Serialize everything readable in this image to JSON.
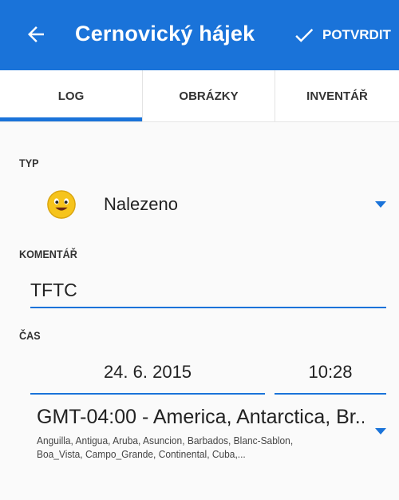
{
  "appbar": {
    "title": "Cernovický hájek",
    "confirm_label": "POTVRDIT",
    "back_icon": "arrow-left-icon",
    "confirm_icon": "check-icon",
    "color": "#1a73d9"
  },
  "tabs": [
    {
      "label": "LOG",
      "selected": true
    },
    {
      "label": "OBRÁZKY",
      "selected": false
    },
    {
      "label": "INVENTÁŘ",
      "selected": false
    }
  ],
  "form": {
    "type_label": "TYP",
    "type_value": "Nalezeno",
    "type_icon": "smiley-icon",
    "comment_label": "KOMENTÁŘ",
    "comment_value": "TFTC",
    "time_label": "ČAS",
    "date_value": "24. 6. 2015",
    "time_value": "10:28",
    "timezone_title": "GMT-04:00 - America, Antarctica, Br...",
    "timezone_detail": "Anguilla, Antigua, Aruba, Asuncion, Barbados, Blanc-Sablon, Boa_Vista, Campo_Grande, Continental, Cuba,..."
  }
}
